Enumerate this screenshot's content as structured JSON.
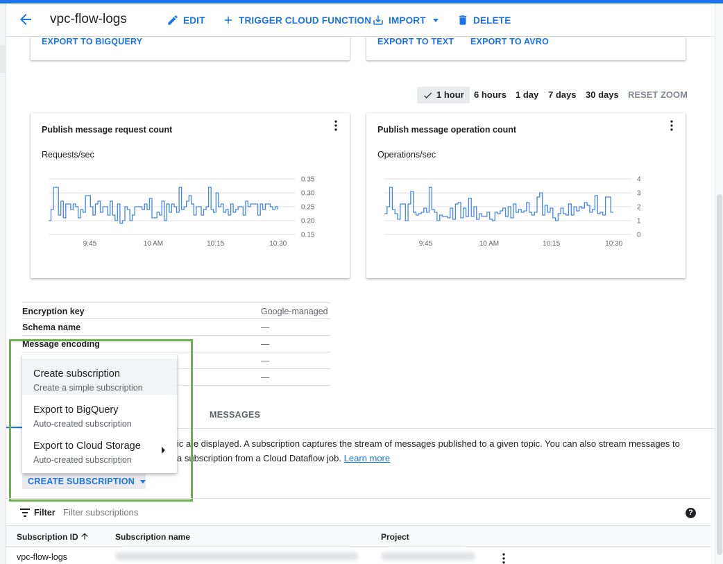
{
  "header": {
    "title": "vpc-flow-logs",
    "edit_label": "EDIT",
    "trigger_label": "TRIGGER CLOUD FUNCTION",
    "import_label": "IMPORT",
    "delete_label": "DELETE"
  },
  "export_links": {
    "bigquery": "EXPORT TO BIGQUERY",
    "text": "EXPORT TO TEXT",
    "avro": "EXPORT TO AVRO"
  },
  "time_range": {
    "options": [
      "1 hour",
      "6 hours",
      "1 day",
      "7 days",
      "30 days"
    ],
    "selected": "1 hour",
    "reset_label": "RESET ZOOM"
  },
  "charts": {
    "left_title": "Publish message request count",
    "left_unit": "Requests/sec",
    "right_title": "Publish message operation count",
    "right_unit": "Operations/sec"
  },
  "chart_data": [
    {
      "type": "line",
      "title": "Publish message request count",
      "ylabel": "Requests/sec",
      "x_ticks": [
        "9:45",
        "10 AM",
        "10:15",
        "10:30"
      ],
      "y_ticks": [
        0.15,
        0.2,
        0.25,
        0.3,
        0.35
      ],
      "ylim": [
        0.15,
        0.35
      ],
      "series": [
        {
          "values": [
            0.2,
            0.24,
            0.32,
            0.32,
            0.22,
            0.27,
            0.21,
            0.26,
            0.26,
            0.24,
            0.26,
            0.25,
            0.21,
            0.24,
            0.23,
            0.29,
            0.29,
            0.25,
            0.22,
            0.26,
            0.27,
            0.23,
            0.25,
            0.25,
            0.22,
            0.27,
            0.22,
            0.2,
            0.26,
            0.19,
            0.2,
            0.25,
            0.24,
            0.2,
            0.22,
            0.25,
            0.25,
            0.25,
            0.24,
            0.26,
            0.24,
            0.28,
            0.21,
            0.21,
            0.23,
            0.22,
            0.27,
            0.2,
            0.26,
            0.23,
            0.26,
            0.25,
            0.23,
            0.32,
            0.24,
            0.25,
            0.27,
            0.29,
            0.26,
            0.22,
            0.25,
            0.25,
            0.22,
            0.24,
            0.25,
            0.32,
            0.24,
            0.23,
            0.3,
            0.25,
            0.26,
            0.23,
            0.24,
            0.22,
            0.26,
            0.23,
            0.24,
            0.25,
            0.25,
            0.22,
            0.27,
            0.25,
            0.26,
            0.26,
            0.26,
            0.22,
            0.26,
            0.24,
            0.26,
            0.26,
            0.25,
            0.24,
            0.25,
            0.24
          ]
        }
      ]
    },
    {
      "type": "line",
      "title": "Publish message operation count",
      "ylabel": "Operations/sec",
      "x_ticks": [
        "9:45",
        "10 AM",
        "10:15",
        "10:30"
      ],
      "y_ticks": [
        0,
        1,
        2,
        3,
        4
      ],
      "ylim": [
        0,
        4
      ],
      "series": [
        {
          "values": [
            1.5,
            2.0,
            3.4,
            1.8,
            1.5,
            1.1,
            2.2,
            2.2,
            1.0,
            2.2,
            3.1,
            1.6,
            1.4,
            1.5,
            1.6,
            1.9,
            1.6,
            3.4,
            1.8,
            1.6,
            1.0,
            1.4,
            1.3,
            1.3,
            1.2,
            1.9,
            1.1,
            2.2,
            2.3,
            1.2,
            1.9,
            1.3,
            2.6,
            1.3,
            2.0,
            1.1,
            1.5,
            1.3,
            1.3,
            1.6,
            1.1,
            1.0,
            1.6,
            1.5,
            1.7,
            1.9,
            1.3,
            2.0,
            1.2,
            2.2,
            1.6,
            1.8,
            1.6,
            1.7,
            2.3,
            1.6,
            1.4,
            1.6,
            2.7,
            3.0,
            1.4,
            2.1,
            1.6,
            1.9,
            1.2,
            1.0,
            1.5,
            1.9,
            1.5,
            1.4,
            2.2,
            1.4,
            2.0,
            1.7,
            2.0,
            1.9,
            2.3,
            2.1,
            1.6,
            1.8,
            2.8,
            1.5,
            1.6,
            1.4,
            2.7,
            2.7,
            1.6,
            1.6
          ]
        }
      ]
    }
  ],
  "details": [
    {
      "key": "Encryption key",
      "value": "Google-managed"
    },
    {
      "key": "Schema name",
      "value": "—"
    },
    {
      "key": "Message encoding",
      "value": "—"
    },
    {
      "key": "",
      "value": "—"
    },
    {
      "key": "",
      "value": "—"
    }
  ],
  "tabs": {
    "messages": "MESSAGES"
  },
  "description": {
    "line1_tail": "ic a e displayed. A subscription captures the stream of messages published to a given topic. You can also stream messages to",
    "line2_tail": "a subscription from a Cloud Dataflow job.",
    "learn_more": "Learn more"
  },
  "menu": {
    "items": [
      {
        "title": "Create subscription",
        "subtitle": "Create a simple subscription"
      },
      {
        "title": "Export to BigQuery",
        "subtitle": "Auto-created subscription"
      },
      {
        "title": "Export to Cloud Storage",
        "subtitle": "Auto-created subscription"
      }
    ]
  },
  "create_button": "CREATE SUBSCRIPTION",
  "filter": {
    "label": "Filter",
    "placeholder": "Filter subscriptions",
    "help_glyph": "?"
  },
  "table": {
    "columns": [
      "Subscription ID",
      "Subscription name",
      "Project"
    ],
    "rows": [
      {
        "id": "vpc-flow-logs"
      }
    ]
  },
  "colors": {
    "accent": "#1a73e8",
    "highlight_border": "#6ab04c"
  }
}
